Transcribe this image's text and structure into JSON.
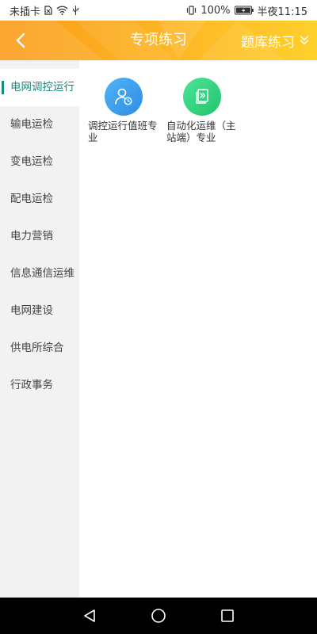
{
  "status_bar": {
    "carrier": "未插卡",
    "battery": "100%",
    "time": "半夜11:15"
  },
  "header": {
    "title": "专项练习",
    "action_label": "题库练习",
    "background_start": "#fb9c1a",
    "background_end": "#ffd02c"
  },
  "sidebar": {
    "active_color": "#1a8a78",
    "items": [
      {
        "label": "电网调控运行"
      },
      {
        "label": "输电运检"
      },
      {
        "label": "变电运检"
      },
      {
        "label": "配电运检"
      },
      {
        "label": "电力营销"
      },
      {
        "label": "信息通信运维"
      },
      {
        "label": "电网建设"
      },
      {
        "label": "供电所综合"
      },
      {
        "label": "行政事务"
      }
    ]
  },
  "main": {
    "tiles": [
      {
        "label": "调控运行值班专业",
        "icon": "user-clock-icon",
        "color": "#3d9ef0"
      },
      {
        "label": "自动化运维（主站端）专业",
        "icon": "document-icon",
        "color": "#33d47c"
      }
    ]
  },
  "nav_bar": {
    "buttons": [
      "back-triangle-icon",
      "home-circle-icon",
      "recents-square-icon"
    ]
  }
}
